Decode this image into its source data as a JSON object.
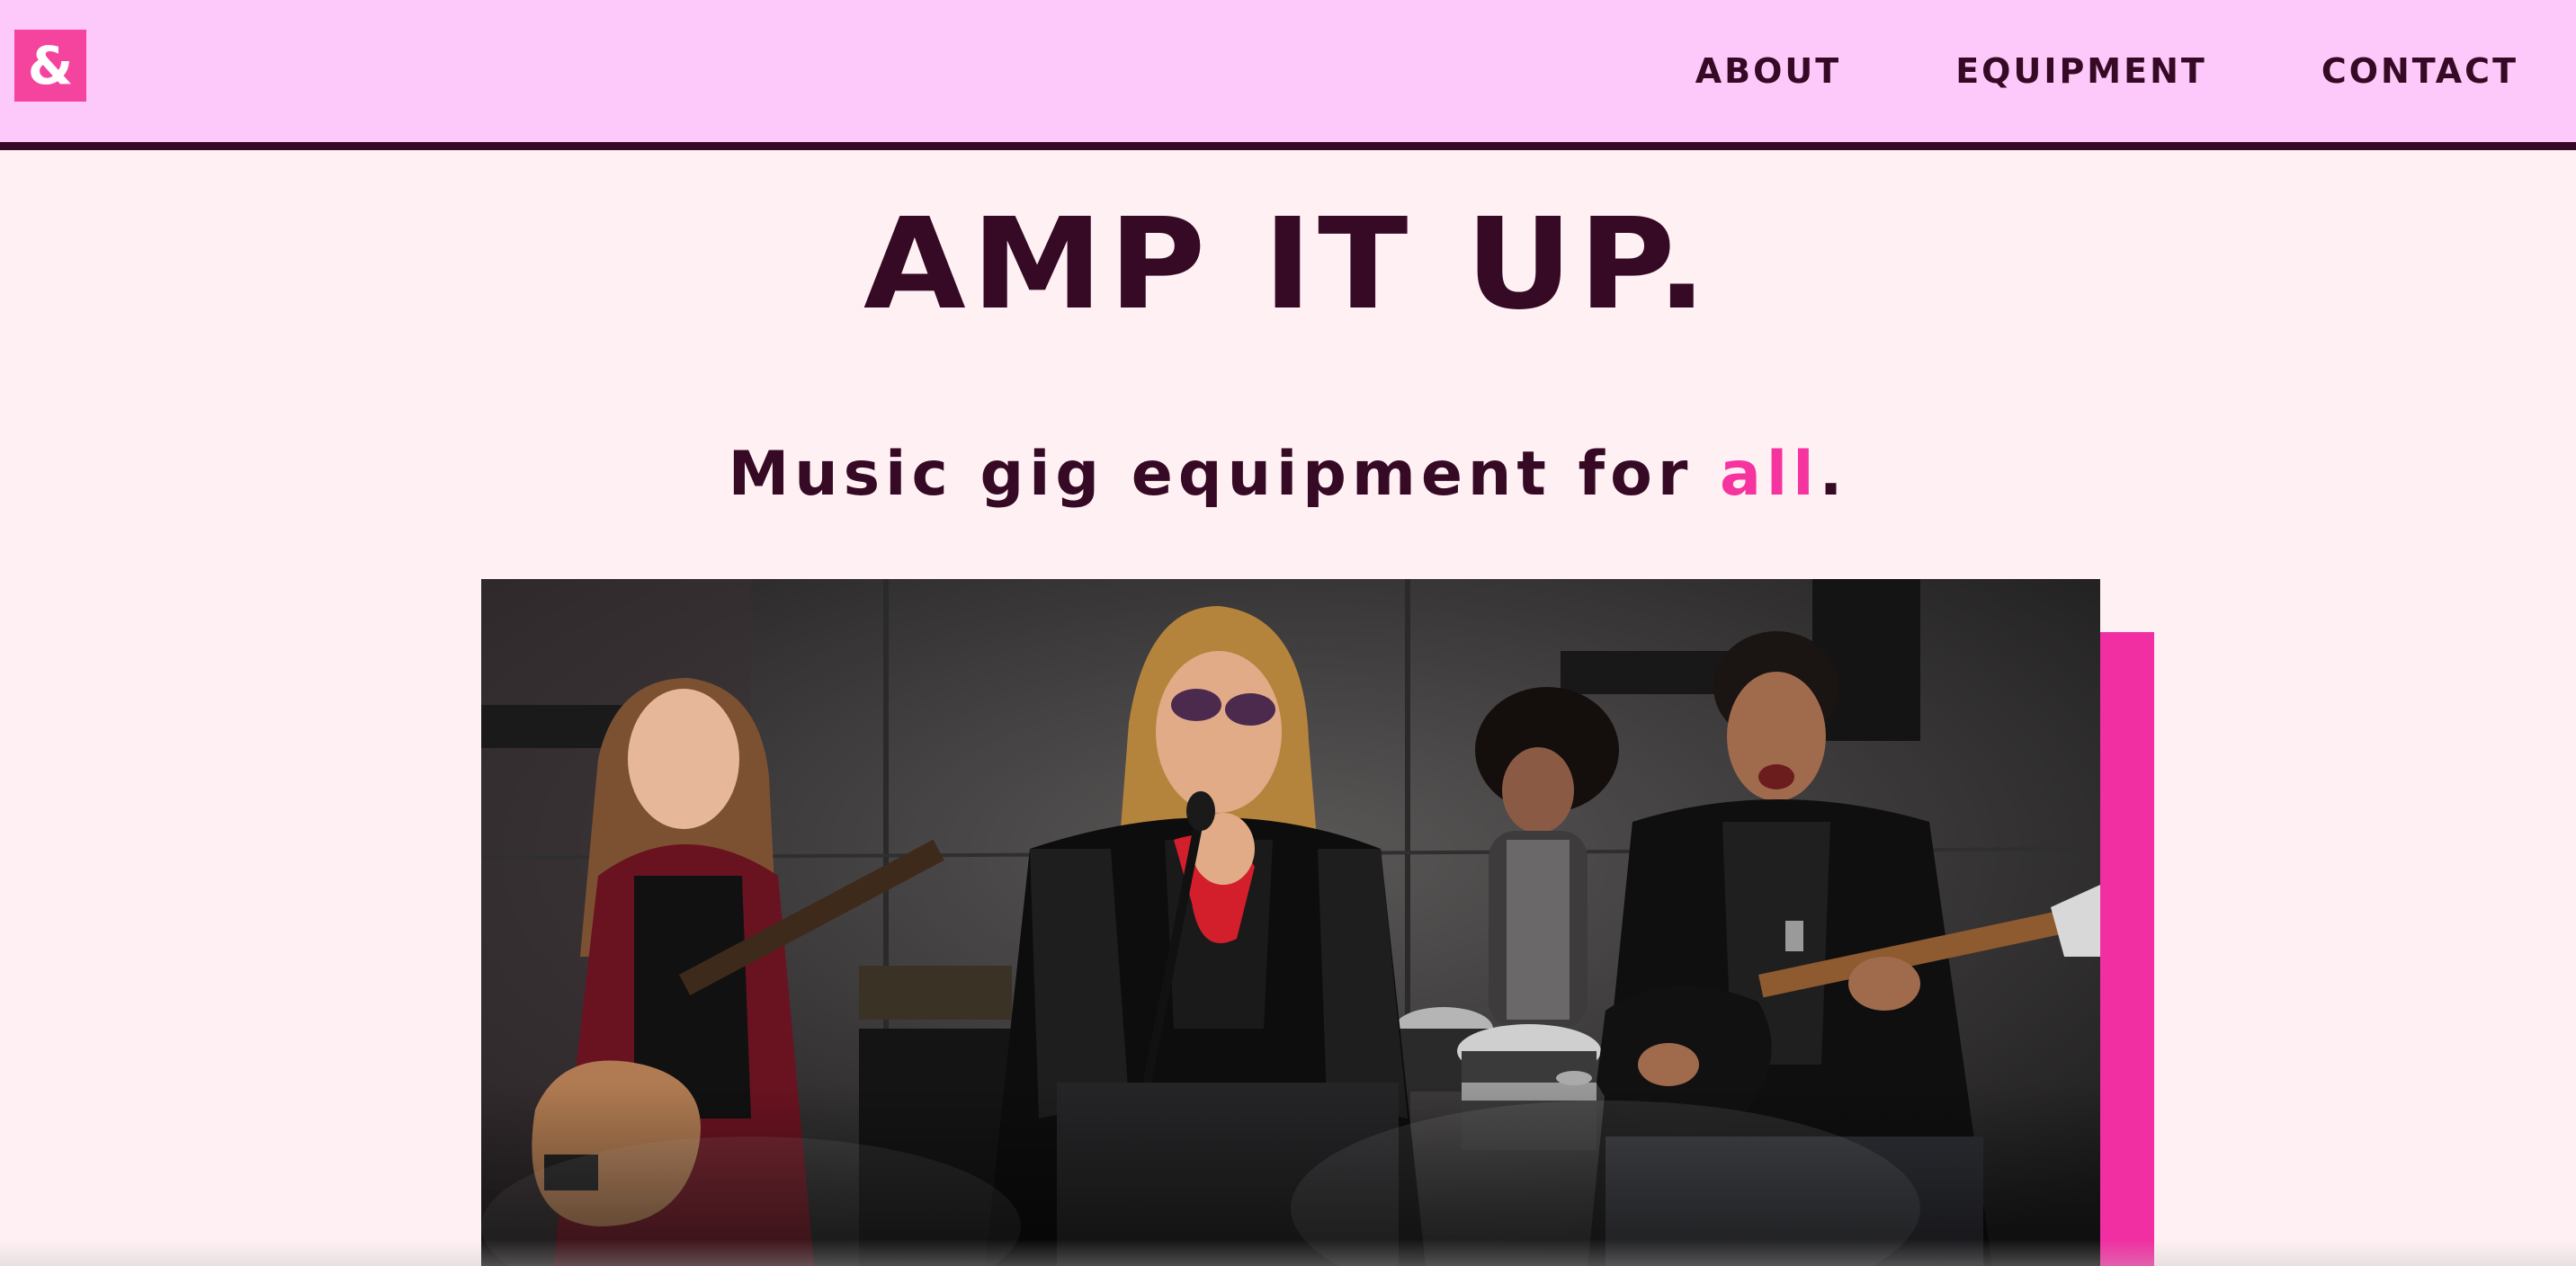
{
  "header": {
    "logo_text": "&",
    "nav": [
      {
        "label": "ABOUT"
      },
      {
        "label": "EQUIPMENT"
      },
      {
        "label": "CONTACT"
      }
    ]
  },
  "hero": {
    "headline": "AMP IT UP.",
    "tagline_prefix": "Music gig equipment for ",
    "tagline_accent": "all",
    "tagline_suffix": ".",
    "image_alt": "Rock band performing with guitars, vocals and drums"
  },
  "colors": {
    "header_bg": "#fdc8fa",
    "page_bg": "#fff1f3",
    "text_dark": "#360a24",
    "accent_pink": "#f5349f"
  }
}
